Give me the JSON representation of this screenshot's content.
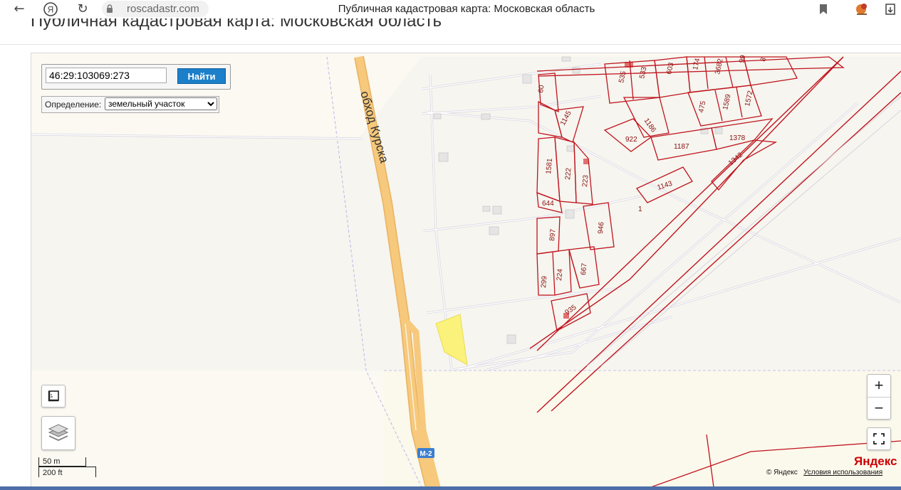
{
  "browser": {
    "url": "roscadastr.com",
    "tab_title": "Публичная кадастровая карта: Московская область"
  },
  "page": {
    "title": "Публичная кадастровая карта: Московская область"
  },
  "search": {
    "value": "46:29:103069:273",
    "button_label": "Найти"
  },
  "definition": {
    "label": "Определение:",
    "selected": "земельный участок"
  },
  "map": {
    "road_label": "обход Курска",
    "highway_badge": "М-2",
    "plot_numbers": [
      "535",
      "533",
      "603",
      "174",
      "3682",
      "99",
      "8",
      "60",
      "1145",
      "1186",
      "475",
      "1589",
      "1572",
      "922",
      "1187",
      "1378",
      "1581",
      "222",
      "223",
      "1342",
      "1143",
      "644",
      "1",
      "897",
      "946",
      "299",
      "224",
      "667",
      "935"
    ],
    "scale": {
      "metric": "50 m",
      "imperial": "200 ft"
    },
    "logo": "Яндекс",
    "copyright": "© Яндекс",
    "terms_link": "Условия использования",
    "zoom_in": "+",
    "zoom_out": "−",
    "colors": {
      "cadastral": "#c0141e",
      "selected_plot": "#faf27a",
      "road": "#f7c97c",
      "search_button": "#1b7fc9"
    }
  }
}
